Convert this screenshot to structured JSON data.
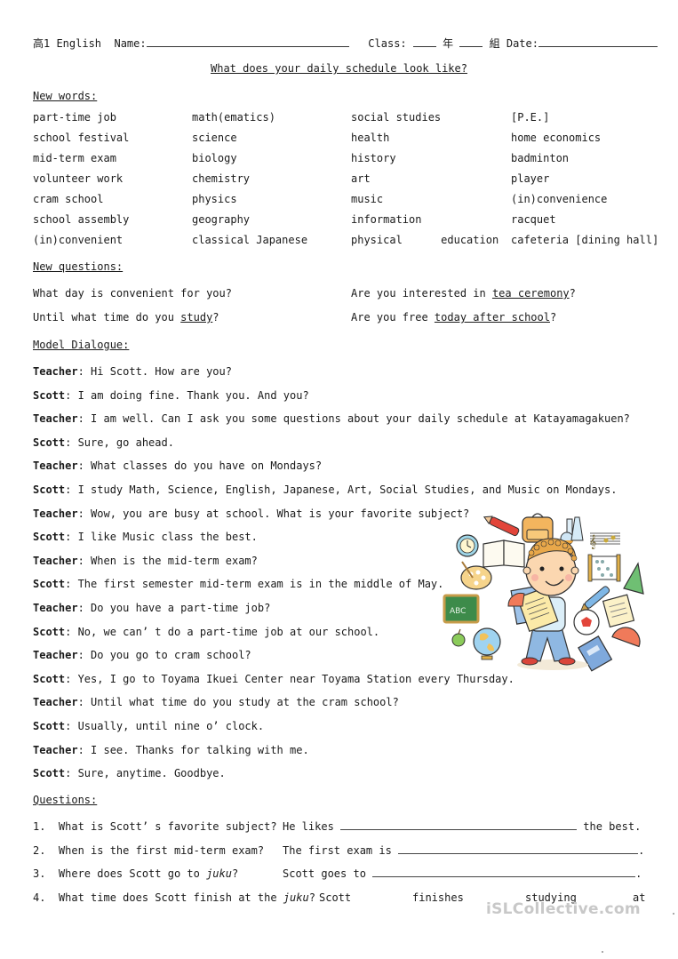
{
  "header": {
    "grade": "高1 English",
    "name_label": "Name:",
    "class_label": "Class:",
    "year_char": "年",
    "group_char": "組",
    "date_label": "Date:"
  },
  "title": "What does your daily schedule look like?",
  "new_words": {
    "heading": "New words:",
    "columns": [
      [
        "part-time job",
        "school festival",
        "mid-term exam",
        "volunteer work",
        "cram school",
        "school assembly",
        "(in)convenient"
      ],
      [
        "math(ematics)",
        "science",
        "biology",
        "chemistry",
        "physics",
        "geography",
        "classical Japanese"
      ],
      [
        "social studies",
        "health",
        "history",
        "art",
        "music",
        "information",
        "physical      education"
      ],
      [
        "[P.E.]",
        "home economics",
        "badminton",
        "player",
        "(in)convenience",
        "racquet",
        "cafeteria [dining hall]"
      ]
    ]
  },
  "new_questions": {
    "heading": "New questions:",
    "items": [
      {
        "before": "What day is convenient for you?",
        "underlined": "",
        "after": ""
      },
      {
        "before": "Are you interested in ",
        "underlined": "tea ceremony",
        "after": "?"
      },
      {
        "before": "Until what time do you ",
        "underlined": "study",
        "after": "?"
      },
      {
        "before": "Are you free ",
        "underlined": "today after school",
        "after": "?"
      }
    ]
  },
  "dialogue": {
    "heading": "Model Dialogue:",
    "lines": [
      {
        "speaker": "Teacher",
        "text": "Hi Scott. How are you?"
      },
      {
        "speaker": "Scott",
        "text": "I am doing fine. Thank you. And you?"
      },
      {
        "speaker": "Teacher",
        "text": "I am well. Can I ask you some questions about your daily schedule at Katayamagakuen?"
      },
      {
        "speaker": "Scott",
        "text": "Sure, go ahead."
      },
      {
        "speaker": "Teacher",
        "text": "What classes do you have on Mondays?"
      },
      {
        "speaker": "Scott",
        "text": "I study Math, Science, English, Japanese, Art, Social Studies, and Music on Mondays."
      },
      {
        "speaker": "Teacher",
        "text": "Wow, you are busy at school. What is your favorite subject?"
      },
      {
        "speaker": "Scott",
        "text": "I like Music class the best."
      },
      {
        "speaker": "Teacher",
        "text": "When is the mid-term exam?"
      },
      {
        "speaker": "Scott",
        "text": "The first semester mid-term exam is in the middle of May."
      },
      {
        "speaker": "Teacher",
        "text": "Do you have a part-time job?"
      },
      {
        "speaker": "Scott",
        "text": "No, we can’ t do a part-time job at our school."
      },
      {
        "speaker": "Teacher",
        "text": "Do you go to cram school?"
      },
      {
        "speaker": "Scott",
        "text": "Yes, I go to Toyama Ikuei Center near Toyama Station every Thursday."
      },
      {
        "speaker": "Teacher",
        "text": "Until what time do you study at the cram school?"
      },
      {
        "speaker": "Scott",
        "text": "Usually, until nine o’ clock."
      },
      {
        "speaker": "Teacher",
        "text": "I see. Thanks for talking with me."
      },
      {
        "speaker": "Scott",
        "text": "Sure, anytime. Goodbye."
      }
    ],
    "separator": ": "
  },
  "questions": {
    "heading": "Questions:",
    "items": [
      {
        "num": "1.",
        "q_before": "What is Scott’ s favorite subject?",
        "q_italic": "",
        "q_after": "",
        "a_before": "He likes",
        "a_after": "the best."
      },
      {
        "num": "2.",
        "q_before": "When is the first mid-term exam?",
        "q_italic": "",
        "q_after": "",
        "a_before": "The first exam is",
        "a_after": "."
      },
      {
        "num": "3.",
        "q_before": "Where does Scott go to ",
        "q_italic": "juku",
        "q_after": "?",
        "a_before": "Scott goes to",
        "a_after": "."
      },
      {
        "num": "4.",
        "q_before": "What time does Scott finish at the ",
        "q_italic": "juku",
        "q_after": "?",
        "a_words": [
          "Scott",
          "finishes",
          "studying",
          "at"
        ]
      }
    ]
  },
  "illustration": {
    "icon": "schoolboy-with-school-supplies-illustration"
  },
  "watermark": "iSLCollective.com",
  "colors": {
    "text": "#1a1a1a",
    "watermark": "#c8c8c8"
  }
}
